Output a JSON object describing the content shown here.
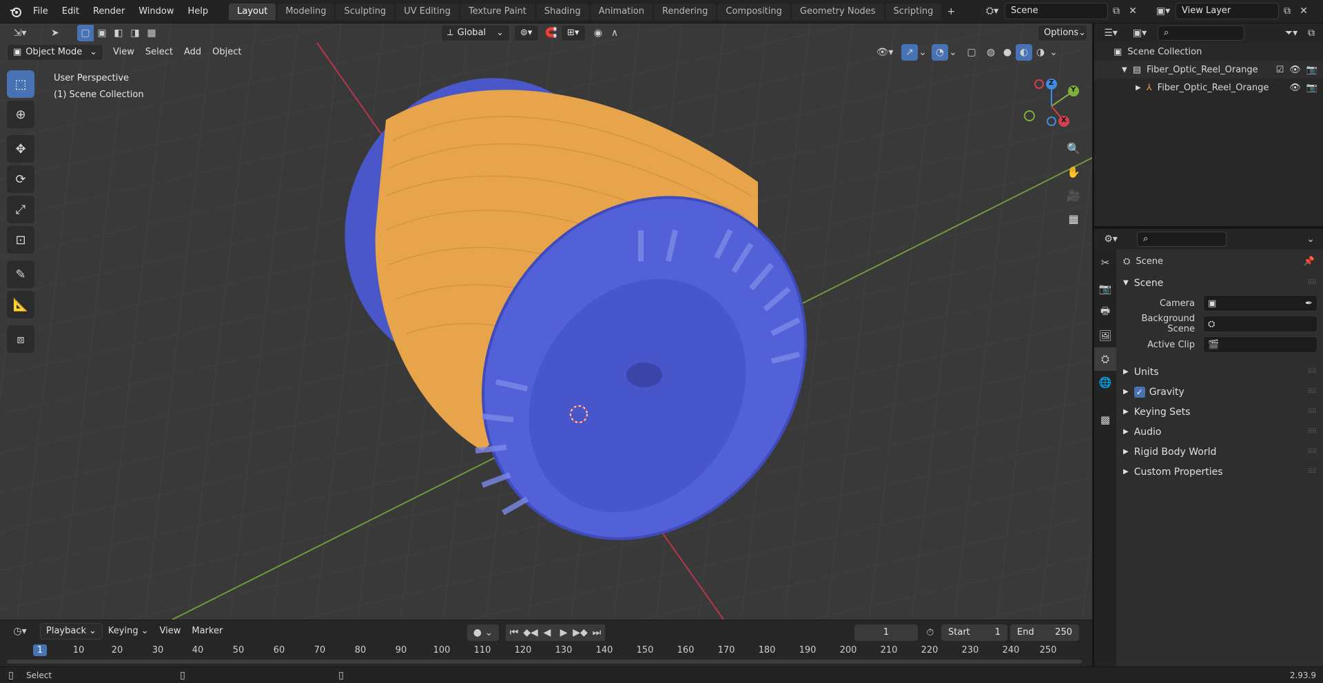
{
  "menu": {
    "items": [
      "File",
      "Edit",
      "Render",
      "Window",
      "Help"
    ]
  },
  "workspaces": [
    "Layout",
    "Modeling",
    "Sculpting",
    "UV Editing",
    "Texture Paint",
    "Shading",
    "Animation",
    "Rendering",
    "Compositing",
    "Geometry Nodes",
    "Scripting"
  ],
  "scene_selector": {
    "value": "Scene"
  },
  "view_layer_selector": {
    "value": "View Layer"
  },
  "viewport": {
    "transform_orientation": "Global",
    "options_label": "Options",
    "mode": "Object Mode",
    "header_menus": [
      "View",
      "Select",
      "Add",
      "Object"
    ],
    "overlay_text": {
      "perspective": "User Perspective",
      "collection": "(1) Scene Collection"
    },
    "gizmo_axes": {
      "z": "Z",
      "y": "Y",
      "x": "X"
    }
  },
  "outliner": {
    "root": "Scene Collection",
    "items": [
      {
        "label": "Fiber_Optic_Reel_Orange",
        "kind": "collection"
      },
      {
        "label": "Fiber_Optic_Reel_Orange",
        "kind": "object"
      }
    ]
  },
  "properties": {
    "context_title": "Scene",
    "scene_section": "Scene",
    "fields": [
      {
        "label": "Camera",
        "value": ""
      },
      {
        "label": "Background Scene",
        "value": ""
      },
      {
        "label": "Active Clip",
        "value": ""
      }
    ],
    "sections": [
      {
        "label": "Units",
        "checkbox": false
      },
      {
        "label": "Gravity",
        "checkbox": true,
        "checked": true
      },
      {
        "label": "Keying Sets",
        "checkbox": false
      },
      {
        "label": "Audio",
        "checkbox": false
      },
      {
        "label": "Rigid Body World",
        "checkbox": false
      },
      {
        "label": "Custom Properties",
        "checkbox": false
      }
    ]
  },
  "timeline": {
    "menus": [
      "Playback",
      "Keying",
      "View",
      "Marker"
    ],
    "current_frame": "1",
    "start_label": "Start",
    "start_value": "1",
    "end_label": "End",
    "end_value": "250",
    "ruler": [
      "1",
      "10",
      "20",
      "30",
      "40",
      "50",
      "60",
      "70",
      "80",
      "90",
      "100",
      "110",
      "120",
      "130",
      "140",
      "150",
      "160",
      "170",
      "180",
      "190",
      "200",
      "210",
      "220",
      "230",
      "240",
      "250"
    ]
  },
  "statusbar": {
    "left": "Select",
    "version": "2.93.9"
  },
  "colors": {
    "accent": "#4772b3",
    "reel_body": "#e8a44a",
    "reel_flange": "#4f5fd6",
    "x_axis": "#d04050",
    "y_axis": "#7fb03a",
    "z_axis": "#3d8de0"
  }
}
